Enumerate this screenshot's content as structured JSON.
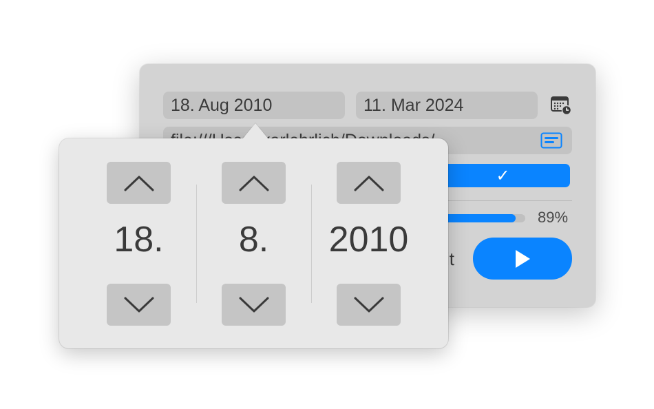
{
  "panel": {
    "start_date": "18. Aug 2010",
    "end_date": "11. Mar 2024",
    "path": "file:///Users/karlehrlich/Downloads/",
    "confirm_glyph": "✓",
    "progress": {
      "value": 89,
      "label": "89%"
    },
    "partial_label": "it",
    "icons": {
      "calendar": "calendar-clock-icon",
      "path": "path-control-icon",
      "play": "play-icon"
    },
    "colors": {
      "accent": "#0a84ff"
    }
  },
  "popover": {
    "columns": [
      {
        "name": "day",
        "value": "18."
      },
      {
        "name": "month",
        "value": "8."
      },
      {
        "name": "year",
        "value": "2010"
      }
    ],
    "icons": {
      "up": "chevron-up-icon",
      "down": "chevron-down-icon"
    }
  }
}
